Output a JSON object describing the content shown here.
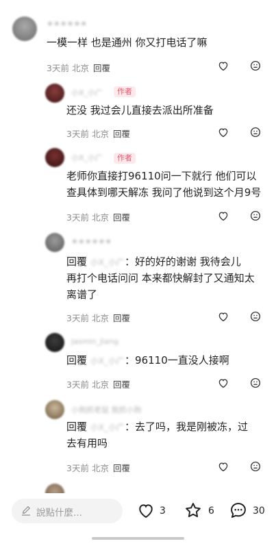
{
  "comments": [
    {
      "name": "★★★★★★",
      "text": "一模一样  也是通州   你又打电话了嘛",
      "time": "3天前",
      "location": "北京",
      "reply": "回覆"
    },
    {
      "name": "小X_小广",
      "badge": "作者",
      "text": "还没 我过会儿直接去派出所准备",
      "time": "3天前",
      "location": "北京",
      "reply": "回覆"
    },
    {
      "name": "小X_小广",
      "badge": "作者",
      "line1": "老师你直接打96110问一下就行 他们可以",
      "line2": "查具体到哪天解冻 我问了他说到这个月9号",
      "time": "3天前",
      "location": "北京",
      "reply": "回覆"
    },
    {
      "name": "★★★★★★",
      "prefix": "回覆",
      "target": "小X_小广",
      "line1": "：好的好的谢谢   我待会儿",
      "line2": "再打个电话问问   本来都快解封了又通知太",
      "line3": "离谱了",
      "time": "3天前",
      "location": "北京",
      "reply": "回覆"
    },
    {
      "name": "Jasmin_Jiang",
      "prefix": "回覆",
      "target": "小X_小广",
      "line1": "：96110一直没人接啊",
      "time": "3天前",
      "location": "北京",
      "reply": "回覆"
    },
    {
      "name": "小狗抓老鼠  我抓小狗",
      "prefix": "回覆",
      "target": "小X_小广",
      "line1": "：去了吗，我是刚被冻，过",
      "line2": "去有用吗",
      "time": "3天前",
      "location": "北京",
      "reply": "回覆"
    }
  ],
  "bottom_bar": {
    "placeholder": "說點什麼...",
    "likes": "3",
    "favorites": "6",
    "comments": "30"
  },
  "icons": {
    "heart": "heart-icon",
    "dislike": "dislike-face-icon",
    "pen": "pen-icon",
    "star": "star-icon",
    "chat": "chat-bubble-icon"
  },
  "colors": {
    "author_badge_text": "#e85b6e",
    "author_badge_bg": "#fde8eb",
    "meta_text": "#8c8c8c"
  }
}
